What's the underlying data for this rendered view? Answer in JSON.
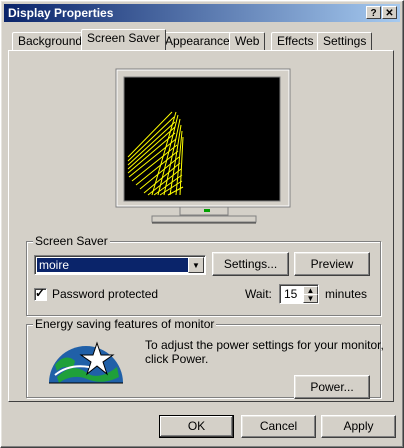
{
  "window": {
    "title": "Display Properties"
  },
  "titlebar": {
    "help": "?",
    "close": "✕"
  },
  "tabs": [
    {
      "label": "Background"
    },
    {
      "label": "Screen Saver"
    },
    {
      "label": "Appearance"
    },
    {
      "label": "Web"
    },
    {
      "label": "Effects"
    },
    {
      "label": "Settings"
    }
  ],
  "screensaver": {
    "group_label": "Screen Saver",
    "selected": "moire",
    "settings_label": "Settings...",
    "preview_label": "Preview",
    "password_label": "Password protected",
    "password_checked": true,
    "wait_label": "Wait:",
    "wait_value": "15",
    "minutes_label": "minutes"
  },
  "energy": {
    "group_label": "Energy saving features of monitor",
    "description_line1": "To adjust the power settings for your monitor,",
    "description_line2": "click Power.",
    "power_label": "Power..."
  },
  "footer": {
    "ok": "OK",
    "cancel": "Cancel",
    "apply": "Apply"
  },
  "colors": {
    "titlebar_start": "#0a246a",
    "titlebar_end": "#a6caf0",
    "selection": "#0a246a",
    "face": "#d4d0c8"
  }
}
